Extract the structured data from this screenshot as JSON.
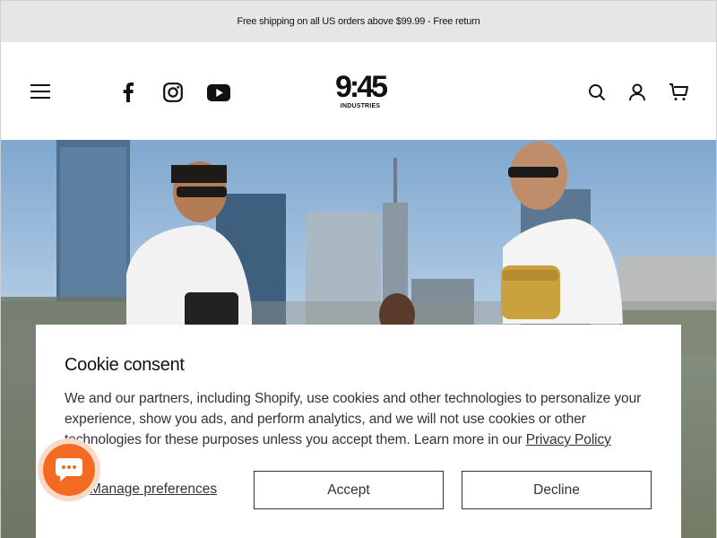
{
  "announcement": {
    "text": "Free shipping on all US orders above $99.99 - Free return"
  },
  "header": {
    "logo": {
      "mark": "9:45",
      "sub": "INDUSTRIES"
    },
    "icons": [
      "menu-icon",
      "facebook-icon",
      "instagram-icon",
      "youtube-icon",
      "search-icon",
      "account-icon",
      "cart-icon"
    ]
  },
  "consent": {
    "title": "Cookie consent",
    "body": "We and our partners, including Shopify, use cookies and other technologies to personalize your experience, show you ads, and perform analytics, and we will not use cookies or other technologies for these purposes unless you accept them. Learn more in our ",
    "link_label": "Privacy Policy",
    "manage_label": "Manage preferences",
    "accept_label": "Accept",
    "decline_label": "Decline"
  },
  "colors": {
    "announcement_bg": "#e6e6e6",
    "chat_accent": "#f26b21"
  }
}
